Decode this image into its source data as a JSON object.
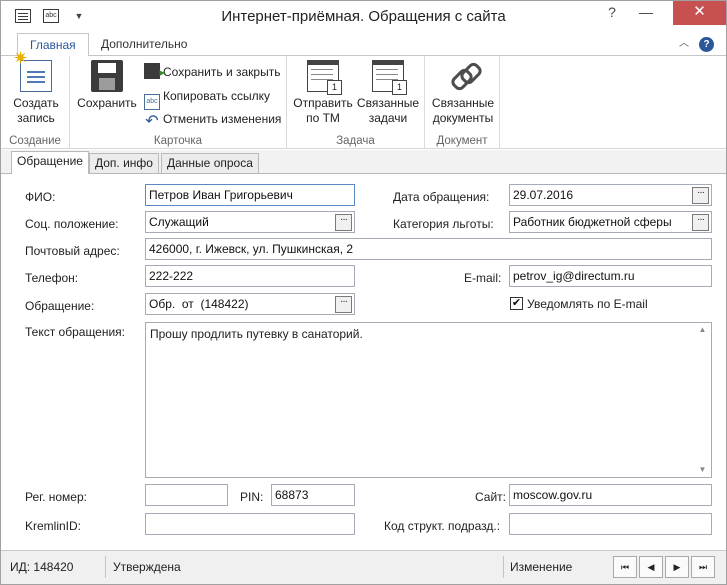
{
  "window": {
    "title": "Интернет-приёмная. Обращения с сайта",
    "quick_access": [
      "form-icon",
      "abc-icon",
      "dropdown-icon"
    ],
    "controls": {
      "help": "?",
      "minimize": "—",
      "close": "✕"
    }
  },
  "ribbon": {
    "tabs": [
      {
        "label": "Главная",
        "active": true
      },
      {
        "label": "Дополнительно",
        "active": false
      }
    ],
    "groups": {
      "create": {
        "label": "Создание",
        "new_record": {
          "line1": "Создать",
          "line2": "запись",
          "icon": "new-record-icon"
        }
      },
      "card": {
        "label": "Карточка",
        "save": {
          "label": "Сохранить",
          "icon": "save-icon"
        },
        "save_close": {
          "label": "Сохранить и закрыть",
          "icon": "save-close-icon"
        },
        "copy_link": {
          "label": "Копировать ссылку",
          "icon": "copy-link-icon"
        },
        "cancel_changes": {
          "label": "Отменить изменения",
          "icon": "undo-icon"
        }
      },
      "task": {
        "label": "Задача",
        "send_tm": {
          "line1": "Отправить",
          "line2": "по ТМ",
          "icon": "calendar-send-icon"
        },
        "related_tasks": {
          "line1": "Связанные",
          "line2": "задачи",
          "icon": "calendar-tasks-icon"
        }
      },
      "document": {
        "label": "Документ",
        "related_docs": {
          "line1": "Связанные",
          "line2": "документы",
          "icon": "chain-link-icon"
        }
      }
    }
  },
  "form_tabs": [
    {
      "label": "Обращение",
      "active": true
    },
    {
      "label": "Доп. инфо",
      "active": false
    },
    {
      "label": "Данные опроса",
      "active": false
    }
  ],
  "form": {
    "fio": {
      "label": "ФИО:",
      "value": "Петров Иван Григорьевич"
    },
    "date": {
      "label": "Дата обращения:",
      "value": "29.07.2016"
    },
    "social": {
      "label": "Соц. положение:",
      "value": "Служащий"
    },
    "benefit": {
      "label": "Категория льготы:",
      "value": "Работник бюджетной сферы"
    },
    "address": {
      "label": "Почтовый адрес:",
      "value": "426000, г. Ижевск, ул. Пушкинская, 2"
    },
    "phone": {
      "label": "Телефон:",
      "value": "222-222"
    },
    "email": {
      "label": "E-mail:",
      "value": "petrov_ig@directum.ru"
    },
    "appeal": {
      "label": "Обращение:",
      "value": "Обр.  от  (148422)"
    },
    "notify": {
      "label": "Уведомлять по E-mail",
      "checked": true
    },
    "text": {
      "label": "Текст обращения:",
      "value": "Прошу продлить путевку в санаторий."
    },
    "reg_number": {
      "label": "Рег. номер:",
      "value": ""
    },
    "pin": {
      "label": "PIN:",
      "value": "68873"
    },
    "site": {
      "label": "Сайт:",
      "value": "moscow.gov.ru"
    },
    "kremlin_id": {
      "label": "KremlinID:",
      "value": ""
    },
    "struct_code": {
      "label": "Код структ. подразд.:",
      "value": ""
    },
    "ellipsis": "···"
  },
  "status_bar": {
    "id_text": "ИД: 148420",
    "state": "Утверждена",
    "mode": "Изменение",
    "nav": {
      "first": "⏮",
      "prev": "◀",
      "next": "▶",
      "last": "⏭"
    }
  }
}
